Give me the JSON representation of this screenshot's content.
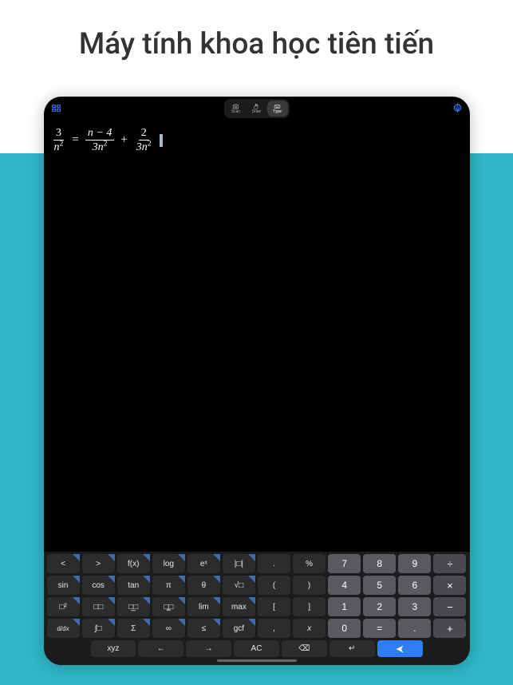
{
  "headline": "Máy tính khoa học tiên tiến",
  "modes": {
    "scan": "Scan",
    "draw": "Draw",
    "type": "Type"
  },
  "equation": {
    "f1": {
      "num": "3",
      "den_a": "n",
      "den_exp": "2"
    },
    "eq": "=",
    "f2": {
      "num": "n − 4",
      "den_a": "3n",
      "den_exp": "2"
    },
    "plus": "+",
    "f3": {
      "num": "2",
      "den_a": "3n",
      "den_exp": "2"
    }
  },
  "keys": {
    "r1": [
      "<",
      ">",
      "f(x)",
      "log",
      "eˣ",
      "|□|",
      ".",
      "%",
      "7",
      "8",
      "9",
      "÷"
    ],
    "r2": [
      "sin",
      "cos",
      "tan",
      "π",
      "θ",
      "√□",
      "(",
      ")",
      "4",
      "5",
      "6",
      "×"
    ],
    "r3": [
      "□²",
      "□□",
      "□̲□",
      "□͇□",
      "lim",
      "max",
      "[",
      "]",
      "1",
      "2",
      "3",
      "−"
    ],
    "r4": [
      "d/dx",
      "∫□",
      "Σ",
      "∞",
      "≤",
      "gcf",
      ",",
      "x",
      "0",
      "=",
      ".",
      "+"
    ],
    "bottom": [
      "xyz",
      "←",
      "→",
      "AC",
      "⌫",
      "↵",
      "▶"
    ]
  }
}
